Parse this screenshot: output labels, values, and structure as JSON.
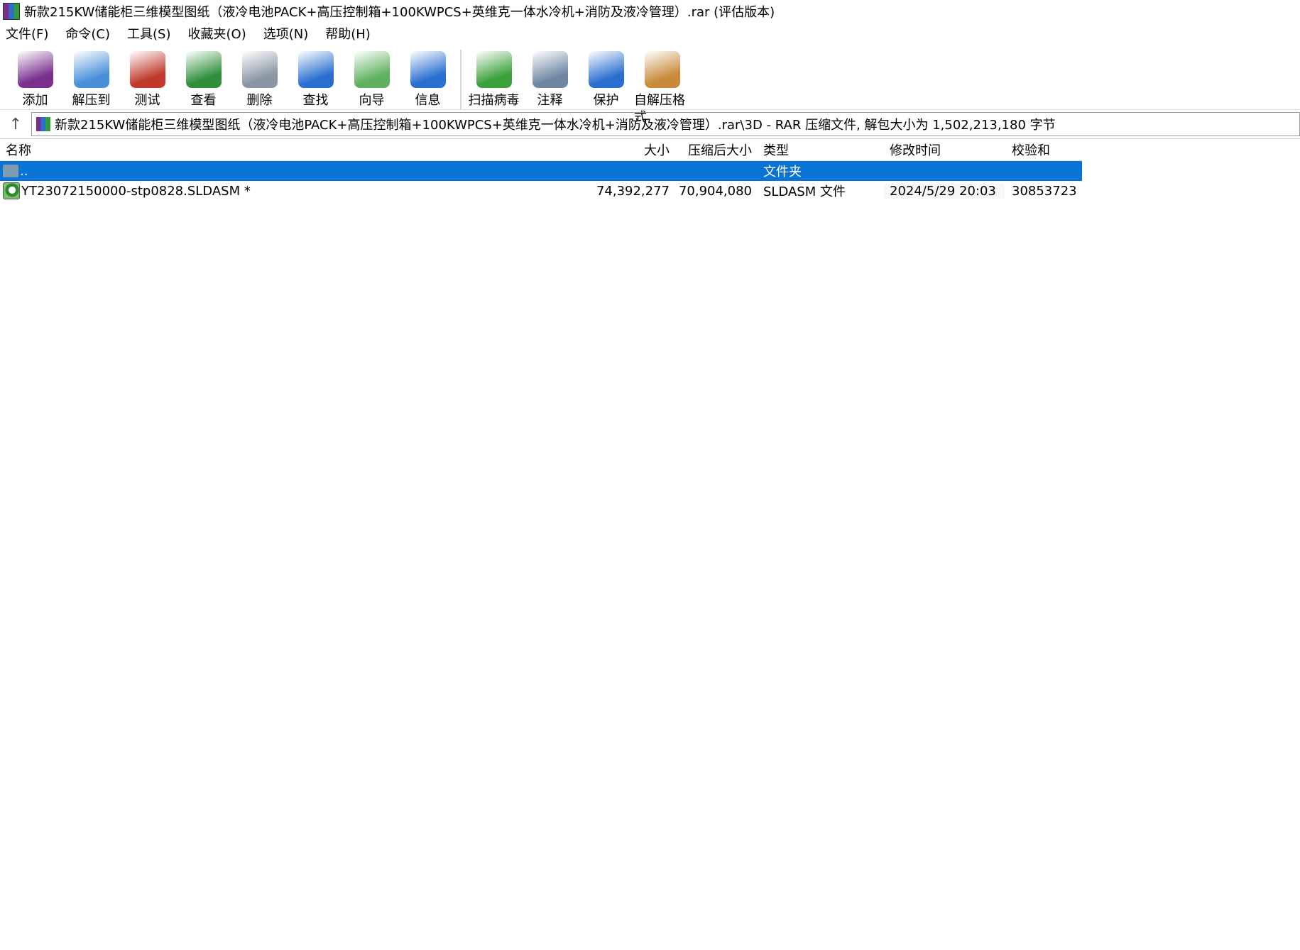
{
  "window": {
    "title": "新款215KW储能柜三维模型图纸（液冷电池PACK+高压控制箱+100KWPCS+英维克一体水冷机+消防及液冷管理）.rar (评估版本)"
  },
  "menu": [
    "文件(F)",
    "命令(C)",
    "工具(S)",
    "收藏夹(O)",
    "选项(N)",
    "帮助(H)"
  ],
  "toolbar": [
    {
      "label": "添加",
      "icon": "add-archive-icon",
      "color": "#7a2f8f"
    },
    {
      "label": "解压到",
      "icon": "extract-folder-icon",
      "color": "#4a90d9"
    },
    {
      "label": "测试",
      "icon": "test-clipboard-icon",
      "color": "#c0392b"
    },
    {
      "label": "查看",
      "icon": "view-book-icon",
      "color": "#2f8f3a"
    },
    {
      "label": "删除",
      "icon": "trash-icon",
      "color": "#8a96a3"
    },
    {
      "label": "查找",
      "icon": "magnifier-icon",
      "color": "#2a6fd0"
    },
    {
      "label": "向导",
      "icon": "wizard-wand-icon",
      "color": "#5fb15f"
    },
    {
      "label": "信息",
      "icon": "info-icon",
      "color": "#2a6fd0"
    },
    {
      "label": "扫描病毒",
      "icon": "virus-scan-icon",
      "color": "#3aa13a"
    },
    {
      "label": "注释",
      "icon": "comment-icon",
      "color": "#6f87a3"
    },
    {
      "label": "保护",
      "icon": "shield-icon",
      "color": "#2a6fd0"
    },
    {
      "label": "自解压格式",
      "icon": "sfx-box-icon",
      "color": "#c98a3a"
    }
  ],
  "path": "新款215KW储能柜三维模型图纸（液冷电池PACK+高压控制箱+100KWPCS+英维克一体水冷机+消防及液冷管理）.rar\\3D - RAR 压缩文件, 解包大小为 1,502,213,180 字节",
  "columns": {
    "name": "名称",
    "size": "大小",
    "packed": "压缩后大小",
    "type": "类型",
    "modified": "修改时间",
    "crc": "校验和"
  },
  "rows": [
    {
      "name": "..",
      "size": "",
      "packed": "",
      "type": "文件夹",
      "modified": "",
      "crc": "",
      "folder": true,
      "selected": true
    },
    {
      "name": "YT23072150000-stp0828.SLDASM *",
      "size": "74,392,277",
      "packed": "70,904,080",
      "type": "SLDASM 文件",
      "modified": "2024/5/29 20:03",
      "crc": "30853723"
    }
  ]
}
